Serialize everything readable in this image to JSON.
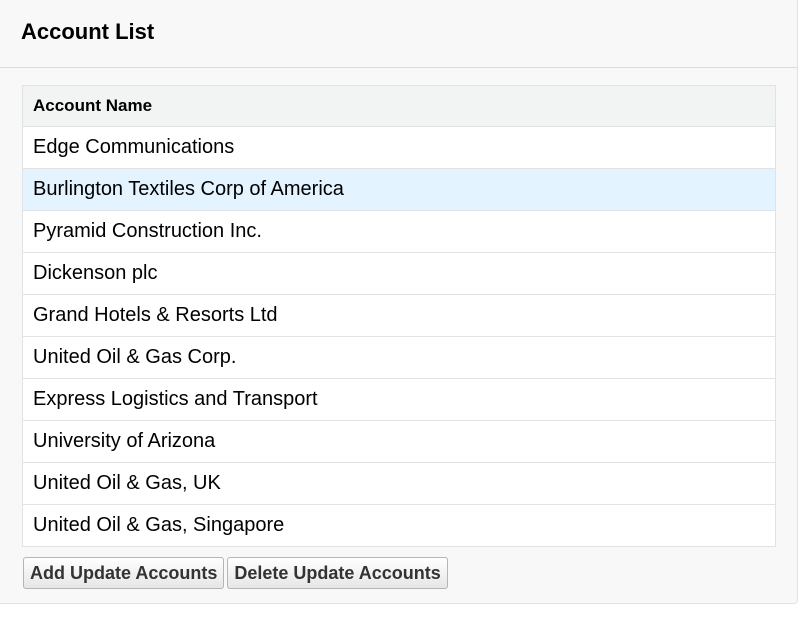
{
  "panel": {
    "title": "Account List"
  },
  "table": {
    "column_header": "Account Name",
    "rows": [
      "Edge Communications",
      "Burlington Textiles Corp of America",
      "Pyramid Construction Inc.",
      "Dickenson plc",
      "Grand Hotels & Resorts Ltd",
      "United Oil & Gas Corp.",
      "Express Logistics and Transport",
      "University of Arizona",
      "United Oil & Gas, UK",
      "United Oil & Gas, Singapore"
    ],
    "highlighted_row_index": 1
  },
  "actions": {
    "add_label": "Add Update Accounts",
    "delete_label": "Delete Update Accounts"
  },
  "colors": {
    "highlight": "#e3f3ff",
    "panel_bg": "#f8f8f8"
  }
}
